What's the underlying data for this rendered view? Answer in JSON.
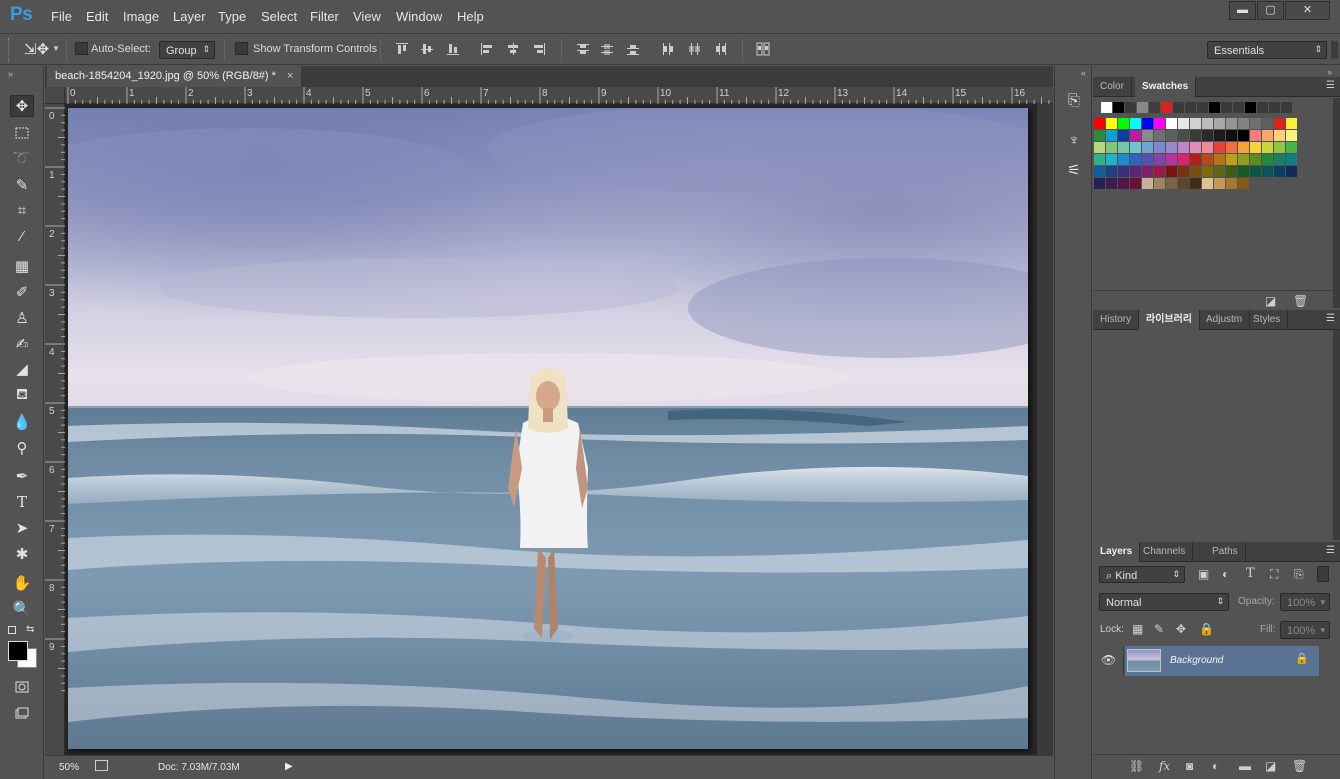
{
  "app": {
    "logo": "Ps"
  },
  "menu": [
    "File",
    "Edit",
    "Image",
    "Layer",
    "Type",
    "Select",
    "Filter",
    "View",
    "Window",
    "Help"
  ],
  "window_controls": {
    "minimize": "▬",
    "maximize": "▢",
    "close": "✕"
  },
  "options": {
    "auto_select_label": "Auto-Select:",
    "auto_select_value": "Group",
    "show_transform_label": "Show Transform Controls",
    "workspace": "Essentials"
  },
  "document": {
    "tab_title": "beach-1854204_1920.jpg @ 50% (RGB/8#) *",
    "ruler_top": [
      "0",
      "1",
      "2",
      "3",
      "4",
      "5",
      "6",
      "7",
      "8",
      "9",
      "10",
      "11",
      "12",
      "13",
      "14",
      "15",
      "16"
    ],
    "ruler_left": [
      "0",
      "1",
      "2",
      "3",
      "4",
      "5",
      "6",
      "7",
      "8",
      "9"
    ],
    "zoom": "50%",
    "doc_info": "Doc: 7.03M/7.03M"
  },
  "swatch_panel": {
    "tabs": [
      "Color",
      "Swatches"
    ],
    "active_tab": "Swatches",
    "recent": [
      "#ffffff",
      "#000000",
      "#3a3a3a",
      "#888888",
      "#3e3e3e",
      "#e01f1f",
      "#3a3a3a",
      "#3a3a3a",
      "#3a3a3a",
      "#000000",
      "#3a3a3a",
      "#3a3a3a",
      "#000000",
      "#3a3a3a",
      "#3a3a3a",
      "#3a3a3a"
    ],
    "rows": [
      [
        "#ff0000",
        "#ffff00",
        "#00ff00",
        "#00ffff",
        "#0000ff",
        "#ff00ff",
        "#ffffff",
        "#e6e6e6",
        "#d0d0d0",
        "#bcbcbc",
        "#a8a8a8",
        "#959595",
        "#828282",
        "#707070",
        "#5e5e5e",
        "#e01f1f",
        "#ffef3a"
      ],
      [
        "#2b8a3e",
        "#0aa1d8",
        "#0a3ea1",
        "#b81da8",
        "#8a8a8a",
        "#707070",
        "#5e5e5e",
        "#4c4c4c",
        "#3a3a3a",
        "#2a2a2a",
        "#1c1c1c",
        "#101010",
        "#000000",
        "#f47c7c",
        "#f9a66c",
        "#fbd17a",
        "#f6f47a"
      ],
      [
        "#b5d67c",
        "#7ec77c",
        "#6fc8a9",
        "#6cc7d3",
        "#6ca7d8",
        "#7b8ad0",
        "#9c86cc",
        "#c083c8",
        "#e58bb8",
        "#f08a98",
        "#e8413c",
        "#f2703c",
        "#f4a23a",
        "#f7d33b",
        "#c6d83b",
        "#8dc63f",
        "#44b649"
      ],
      [
        "#2eb08a",
        "#1ab5c8",
        "#1c8cd2",
        "#2c63bd",
        "#5a4fb2",
        "#8242a8",
        "#b8339a",
        "#e0216f",
        "#b51d1f",
        "#b84b1a",
        "#b97418",
        "#b9a315",
        "#8f9c1c",
        "#5c8b22",
        "#1f8a3c",
        "#198065",
        "#137c89"
      ],
      [
        "#115f9a",
        "#1e3f86",
        "#3a2f80",
        "#5a267a",
        "#7e1f6c",
        "#9d174d",
        "#7a1414",
        "#7a3311",
        "#7a4e0e",
        "#7a6c0b",
        "#5e6712",
        "#3c5c16",
        "#145c28",
        "#0f5543",
        "#0c535b",
        "#0b3f67",
        "#142a5c"
      ],
      [
        "#261f58",
        "#3c1a52",
        "#531549",
        "#6a1034",
        "#c7b299",
        "#9d8566",
        "#7b6443",
        "#5c4629",
        "#3f2e17",
        "#e2c28c",
        "#c49a5a",
        "#a87831",
        "#885918"
      ]
    ]
  },
  "mid_panel_tabs": [
    "History",
    "라이브러리",
    "Adjustm",
    "Styles"
  ],
  "mid_panel_active": "라이브러리",
  "layers_panel": {
    "tabs": [
      "Layers",
      "Channels",
      "Paths"
    ],
    "active_tab": "Layers",
    "filter_label": "Kind",
    "blend_mode": "Normal",
    "opacity_label": "Opacity:",
    "opacity_value": "100%",
    "lock_label": "Lock:",
    "fill_label": "Fill:",
    "fill_value": "100%",
    "layers": [
      {
        "name": "Background",
        "visible": true,
        "locked": true
      }
    ]
  }
}
